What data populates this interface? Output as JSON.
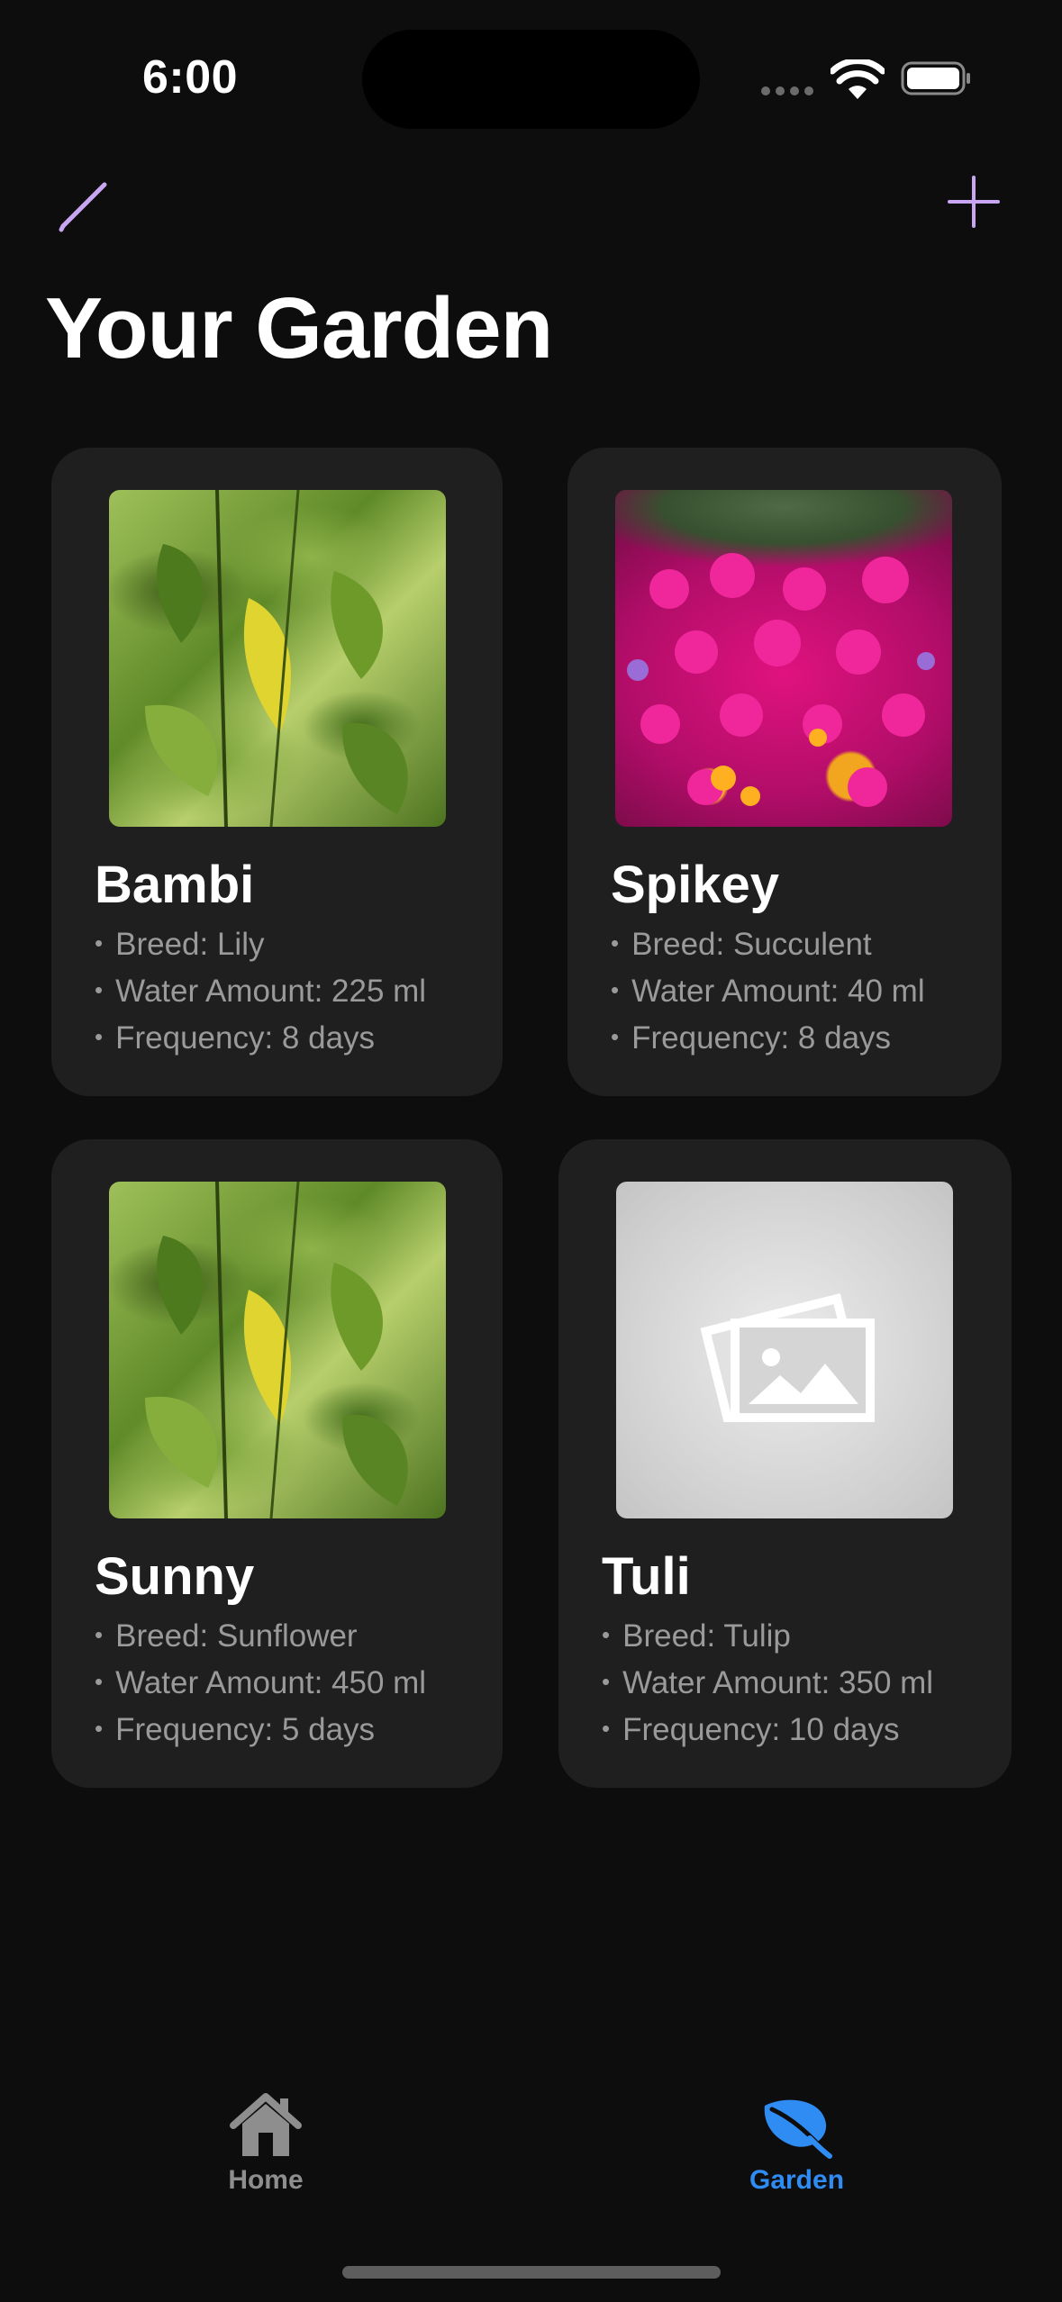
{
  "status_bar": {
    "time": "6:00"
  },
  "toolbar": {
    "edit_icon": "pencil-icon",
    "add_icon": "plus-icon"
  },
  "page": {
    "title": "Your Garden"
  },
  "plants": [
    {
      "name": "Bambi",
      "breed": "Breed: Lily",
      "water": "Water Amount: 225 ml",
      "frequency": "Frequency: 8 days",
      "image": "leaf-photo"
    },
    {
      "name": "Spikey",
      "breed": "Breed: Succulent",
      "water": "Water Amount: 40 ml",
      "frequency": "Frequency: 8 days",
      "image": "flower-photo"
    },
    {
      "name": "Sunny",
      "breed": "Breed: Sunflower",
      "water": "Water Amount: 450 ml",
      "frequency": "Frequency: 5 days",
      "image": "leaf-photo"
    },
    {
      "name": "Tuli",
      "breed": "Breed: Tulip",
      "water": "Water Amount: 350 ml",
      "frequency": "Frequency: 10 days",
      "image": "placeholder-photo-icon"
    }
  ],
  "tab_bar": {
    "home_label": "Home",
    "garden_label": "Garden",
    "active": "Garden"
  },
  "colors": {
    "accent": "#c8a6f2",
    "tab_active": "#2f8cf3",
    "tab_inactive": "#8e8e8e",
    "card_bg": "#1f1f1f",
    "background": "#0d0d0d"
  }
}
